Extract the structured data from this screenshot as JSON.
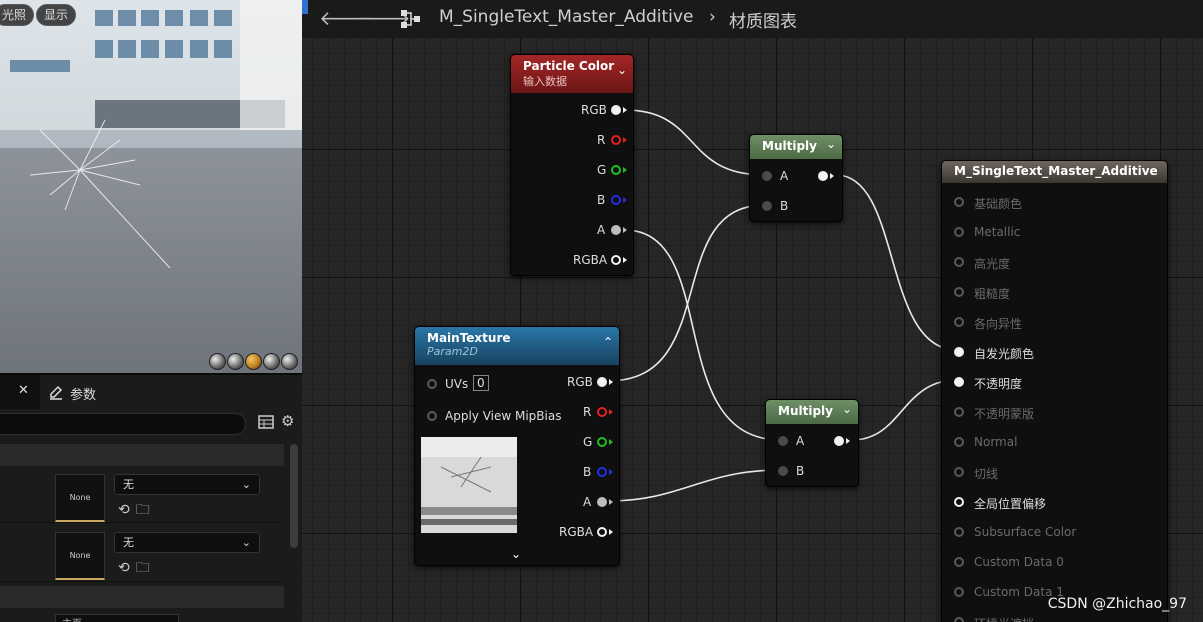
{
  "viewport": {
    "buttons": [
      "光照",
      "显示"
    ]
  },
  "details": {
    "tab_close": "✕",
    "tab_label": "参数",
    "rows": [
      {
        "thumb": "None",
        "dropdown": "无"
      },
      {
        "thumb": "None",
        "dropdown": "无"
      }
    ],
    "bottom_input": "主页"
  },
  "graph": {
    "breadcrumb_asset": "M_SingleText_Master_Additive",
    "breadcrumb_sep": "›",
    "breadcrumb_view": "材质图表",
    "nodes": {
      "particle_color": {
        "title": "Particle Color",
        "subtitle": "输入数据",
        "pins": [
          "RGB",
          "R",
          "G",
          "B",
          "A",
          "RGBA"
        ]
      },
      "multiply_top": {
        "title": "Multiply",
        "pins": [
          "A",
          "B"
        ]
      },
      "multiply_bottom": {
        "title": "Multiply",
        "pins": [
          "A",
          "B"
        ]
      },
      "main_texture": {
        "title": "MainTexture",
        "subtitle": "Param2D",
        "inputs": [
          "UVs",
          "Apply View MipBias"
        ],
        "uvs_value": "0",
        "pins": [
          "RGB",
          "R",
          "G",
          "B",
          "A",
          "RGBA"
        ]
      },
      "result": {
        "title": "M_SingleText_Master_Additive",
        "pins": [
          {
            "label": "基础颜色",
            "active": false
          },
          {
            "label": "Metallic",
            "active": false
          },
          {
            "label": "高光度",
            "active": false
          },
          {
            "label": "粗糙度",
            "active": false
          },
          {
            "label": "各向异性",
            "active": false
          },
          {
            "label": "自发光颜色",
            "active": true
          },
          {
            "label": "不透明度",
            "active": true
          },
          {
            "label": "不透明蒙版",
            "active": false
          },
          {
            "label": "Normal",
            "active": false
          },
          {
            "label": "切线",
            "active": false
          },
          {
            "label": "全局位置偏移",
            "active": true
          },
          {
            "label": "Subsurface Color",
            "active": false
          },
          {
            "label": "Custom Data 0",
            "active": false
          },
          {
            "label": "Custom Data 1",
            "active": false
          },
          {
            "label": "环境光遮挡",
            "active": false
          }
        ]
      }
    }
  },
  "watermark": "CSDN @Zhichao_97",
  "colors": {
    "particle_header": "#8a1f1f",
    "multiply_header": "#5e7d57",
    "texture_header": "#1f5e86",
    "result_header": "#5c544e"
  }
}
